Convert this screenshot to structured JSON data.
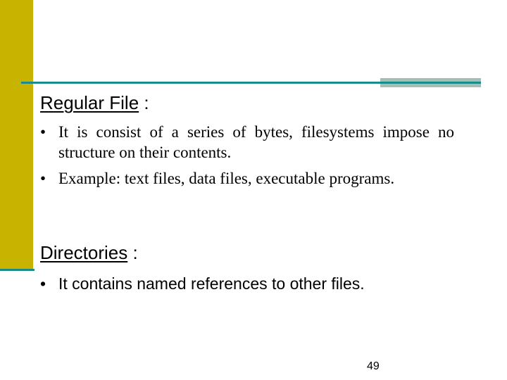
{
  "colors": {
    "gold": "#C8B400",
    "teal": "#1A8A8A",
    "grayteal": "#A3BFB5"
  },
  "sections": [
    {
      "title": "Regular File",
      "suffix": " :",
      "bullet": "•",
      "items": [
        "It is consist of a series of bytes, filesystems impose no structure on their contents.",
        "Example: text files, data files, executable programs."
      ]
    },
    {
      "title": "Directories",
      "suffix": " :",
      "bullet": "•",
      "items": [
        "It contains named references to other files."
      ]
    }
  ],
  "page_number": "49"
}
